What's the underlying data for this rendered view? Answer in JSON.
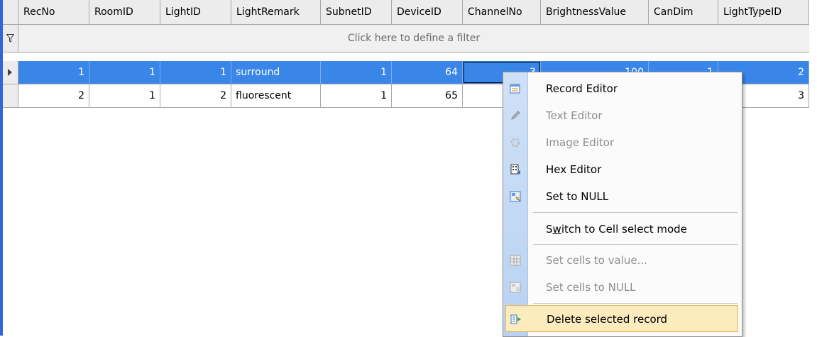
{
  "columns": [
    "RecNo",
    "RoomID",
    "LightID",
    "LightRemark",
    "SubnetID",
    "DeviceID",
    "ChannelNo",
    "BrightnessValue",
    "CanDim",
    "LightTypeID"
  ],
  "filter_text": "Click here to define a filter",
  "rows": [
    {
      "RecNo": "1",
      "RoomID": "1",
      "LightID": "1",
      "LightRemark": "surround",
      "SubnetID": "1",
      "DeviceID": "64",
      "ChannelNo": "3",
      "BrightnessValue": "100",
      "CanDim": "1",
      "LightTypeID": "2"
    },
    {
      "RecNo": "2",
      "RoomID": "1",
      "LightID": "2",
      "LightRemark": "fluorescent",
      "SubnetID": "1",
      "DeviceID": "65",
      "ChannelNo": "",
      "BrightnessValue": "",
      "CanDim": "",
      "LightTypeID": "3"
    }
  ],
  "context_menu": {
    "record_editor": "Record Editor",
    "text_editor": "Text Editor",
    "image_editor": "Image Editor",
    "hex_editor": "Hex Editor",
    "set_to_null": "Set to NULL",
    "switch_cell_mode_pre": "S",
    "switch_cell_mode_u": "w",
    "switch_cell_mode_post": "itch to Cell select mode",
    "set_cells_value": "Set cells to value...",
    "set_cells_null": "Set cells to NULL",
    "delete_record": "Delete selected record"
  },
  "colors": {
    "selection": "#3a86e8",
    "menu_hover": "#fcebbd",
    "accent_border": "#2f67d8"
  }
}
